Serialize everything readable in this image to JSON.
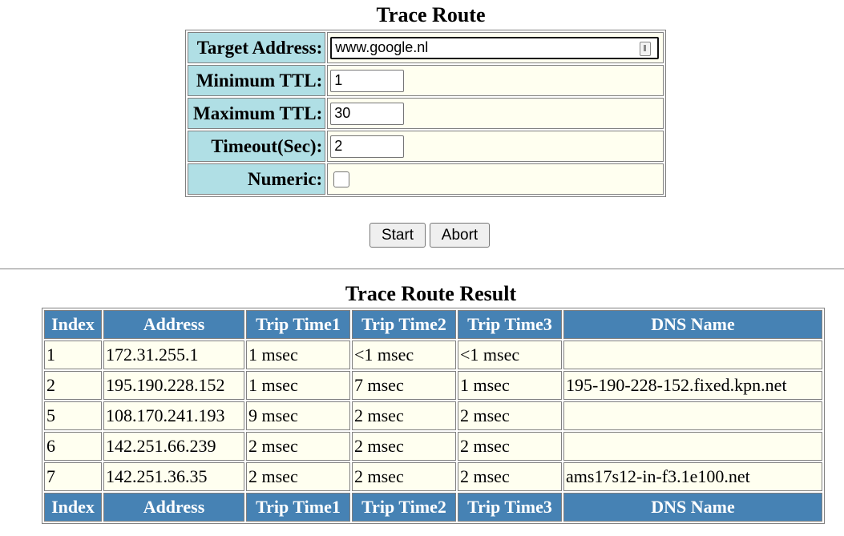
{
  "form": {
    "title": "Trace Route",
    "fields": [
      {
        "label": "Target Address:",
        "value": "www.google.nl"
      },
      {
        "label": "Minimum TTL:",
        "value": "1"
      },
      {
        "label": "Maximum TTL:",
        "value": "30"
      },
      {
        "label": "Timeout(Sec):",
        "value": "2"
      },
      {
        "label": "Numeric:",
        "checked": false
      }
    ],
    "start_label": "Start",
    "abort_label": "Abort"
  },
  "result": {
    "title": "Trace Route Result",
    "columns": [
      "Index",
      "Address",
      "Trip Time1",
      "Trip Time2",
      "Trip Time3",
      "DNS Name"
    ],
    "rows": [
      [
        "1",
        "172.31.255.1",
        "1 msec",
        "<1 msec",
        "<1 msec",
        ""
      ],
      [
        "2",
        "195.190.228.152",
        "1 msec",
        "7 msec",
        "1 msec",
        "195-190-228-152.fixed.kpn.net"
      ],
      [
        "5",
        "108.170.241.193",
        "9 msec",
        "2 msec",
        "2 msec",
        ""
      ],
      [
        "6",
        "142.251.66.239",
        "2 msec",
        "2 msec",
        "2 msec",
        ""
      ],
      [
        "7",
        "142.251.36.35",
        "2 msec",
        "2 msec",
        "2 msec",
        "ams17s12-in-f3.1e100.net"
      ]
    ]
  },
  "colors": {
    "label_bg": "#b0dfe5",
    "value_bg": "#fffff0",
    "header_bg": "#4682b4",
    "header_text": "#ffffff"
  }
}
